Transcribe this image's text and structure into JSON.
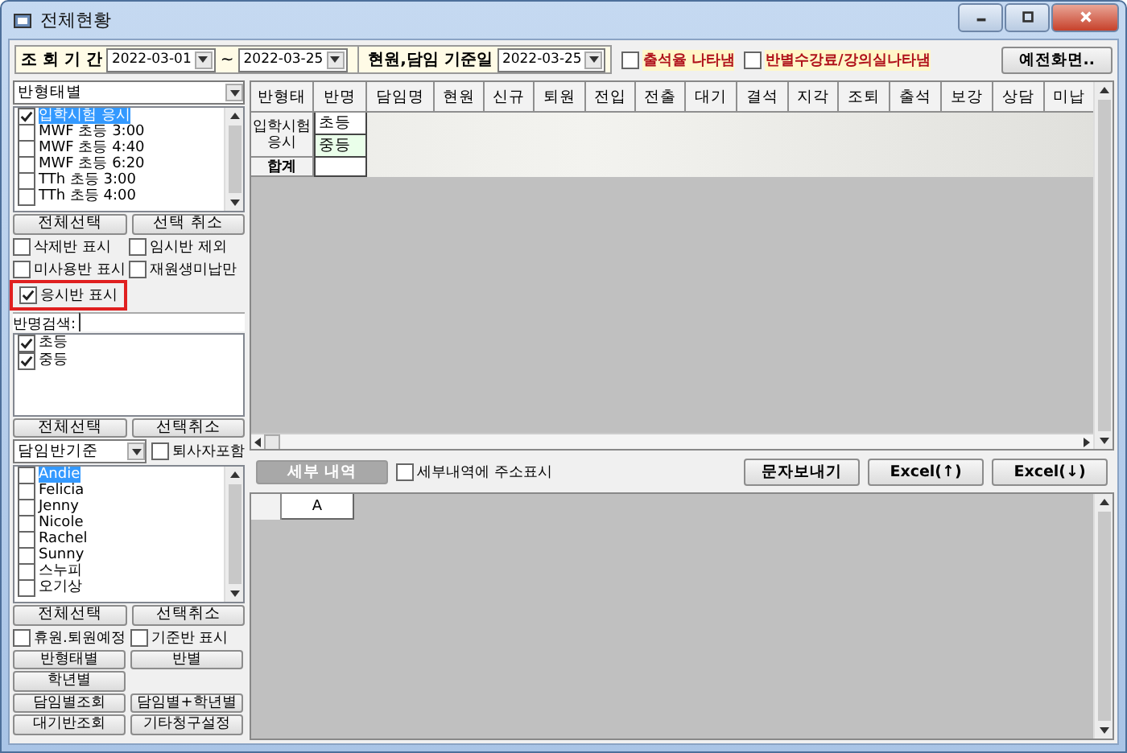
{
  "window": {
    "title": "전체현황"
  },
  "query": {
    "period_label": "조 회 기 간",
    "start_date": "2022-03-01",
    "separator": "~",
    "end_date": "2022-03-25",
    "base_label": "현원,담임 기준일",
    "base_date": "2022-03-25"
  },
  "display_options": [
    {
      "label": "출석율 나타냄",
      "checked": false
    },
    {
      "label": "반별수강료/강의실나타냄",
      "checked": false
    }
  ],
  "previous_screen_button": "예전화면..",
  "class_type": {
    "dropdown": "반형태별",
    "items": [
      {
        "label": "입학시험 응시",
        "checked": true,
        "selected": true
      },
      {
        "label": "MWF 초등 3:00",
        "checked": false,
        "selected": false
      },
      {
        "label": "MWF 초등 4:40",
        "checked": false,
        "selected": false
      },
      {
        "label": "MWF 초등 6:20",
        "checked": false,
        "selected": false
      },
      {
        "label": "TTh 초등 3:00",
        "checked": false,
        "selected": false
      },
      {
        "label": "TTh 초등 4:00",
        "checked": false,
        "selected": false
      }
    ],
    "select_all": "전체선택",
    "deselect": "선택 취소"
  },
  "class_options": [
    {
      "label": "삭제반 표시",
      "checked": false,
      "highlighted": false
    },
    {
      "label": "임시반 제외",
      "checked": false,
      "highlighted": false
    },
    {
      "label": "미사용반 표시",
      "checked": false,
      "highlighted": false
    },
    {
      "label": "재원생미납만",
      "checked": false,
      "highlighted": false
    },
    {
      "label": "응시반 표시",
      "checked": true,
      "highlighted": true
    }
  ],
  "class_search": {
    "label": "반명검색:"
  },
  "class_names": {
    "items": [
      {
        "label": "초등",
        "checked": true
      },
      {
        "label": "중등",
        "checked": true
      }
    ],
    "select_all": "전체선택",
    "deselect": "선택취소"
  },
  "teacher": {
    "dropdown": "담임반기준",
    "include_retired": {
      "label": "퇴사자포함",
      "checked": false
    },
    "items": [
      {
        "label": "Andie",
        "checked": false,
        "selected": true
      },
      {
        "label": "Felicia",
        "checked": false,
        "selected": false
      },
      {
        "label": "Jenny",
        "checked": false,
        "selected": false
      },
      {
        "label": "Nicole",
        "checked": false,
        "selected": false
      },
      {
        "label": "Rachel",
        "checked": false,
        "selected": false
      },
      {
        "label": "Sunny",
        "checked": false,
        "selected": false
      },
      {
        "label": "스누피",
        "checked": false,
        "selected": false
      },
      {
        "label": "오기상",
        "checked": false,
        "selected": false
      }
    ],
    "select_all": "전체선택",
    "deselect": "선택취소"
  },
  "teacher_options": [
    {
      "label": "휴원.퇴원예정",
      "checked": false
    },
    {
      "label": "기준반 표시",
      "checked": false
    }
  ],
  "view_buttons": [
    [
      "반형태별",
      "반별"
    ],
    [
      "학년별"
    ],
    [
      "담임별조회",
      "담임별+학년별"
    ],
    [
      "대기반조회",
      "기타청구설정"
    ]
  ],
  "summary_table": {
    "columns": [
      "반형태",
      "반명",
      "담임명",
      "현원",
      "신규",
      "퇴원",
      "전입",
      "전출",
      "대기",
      "결석",
      "지각",
      "조퇴",
      "출석",
      "보강",
      "상담",
      "미납"
    ],
    "groups": [
      {
        "label": "입학시험 응시",
        "rows": [
          {
            "name": "초등",
            "selected": false
          },
          {
            "name": "중등",
            "selected": true
          }
        ]
      }
    ],
    "total_label": "합계"
  },
  "detail_bar": {
    "detail_button": {
      "label": "세부 내역",
      "disabled": true
    },
    "address_option": {
      "label": "세부내역에 주소표시",
      "checked": false
    },
    "buttons": [
      "문자보내기",
      "Excel(↑)",
      "Excel(↓)"
    ]
  },
  "detail_table": {
    "columns": [
      "A"
    ]
  }
}
